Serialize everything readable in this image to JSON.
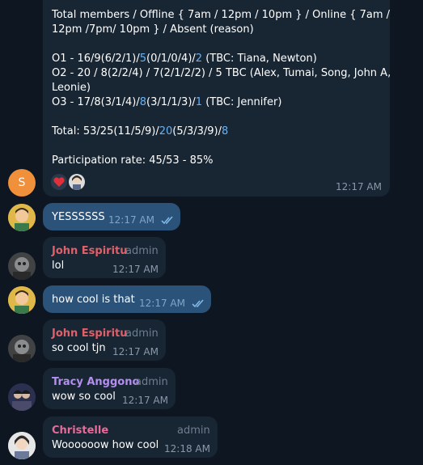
{
  "colors": {
    "background": "#0e1621",
    "incoming_bubble": "#182533",
    "outgoing_bubble": "#2b5278",
    "link": "#6ab3f3",
    "time": "#8a99a9",
    "admin": "#6d7f8f",
    "john_name": "#e0606a",
    "tracy_name": "#b48ef0",
    "christelle_name": "#e86c9a",
    "s_avatar": "#f0903a"
  },
  "summary_message": {
    "line1": "Total members / Offline { 7am / 12pm / 10pm } / Online { 7am /",
    "line2": "12pm /7pm/ 10pm } / Absent (reason)",
    "o1_a": "O1 - 16/9(6/2/1)/",
    "o1_b": "5",
    "o1_c": "(0/1/0/4)/",
    "o1_d": "2",
    "o1_e": " (TBC: Tiana, Newton)",
    "o2_line1": "O2 - 20 / 8(2/2/4) / 7(2/1/2/2) / 5 TBC (Alex, Tumai, Song, John A,",
    "o2_line2": "Leonie)",
    "o3_a": "O3 - 17/8(3/1/4)/",
    "o3_b": "8",
    "o3_c": "(3/1/1/3)/",
    "o3_d": "1",
    "o3_e": " (TBC: Jennifer)",
    "total_a": "Total: 53/25(11/5/9)/",
    "total_b": "20",
    "total_c": "(5/3/3/9)/",
    "total_d": "8",
    "participation": "Participation rate: 45/53 - 85%",
    "time": "12:17 AM",
    "avatar_letter": "S"
  },
  "messages": [
    {
      "text": "YESSSSSS",
      "time": "12:17 AM"
    },
    {
      "sender": "John Espiritu",
      "role": "admin",
      "text": "lol",
      "time": "12:17 AM"
    },
    {
      "text": "how cool is that",
      "time": "12:17 AM"
    },
    {
      "sender": "John Espiritu",
      "role": "admin",
      "text": "so cool tjn",
      "time": "12:17 AM"
    },
    {
      "sender": "Tracy Anggono",
      "role": "admin",
      "text": "wow so cool",
      "time": "12:17 AM"
    },
    {
      "sender": "Christelle",
      "role": "admin",
      "text": "Woooooow how cool",
      "time": "12:18 AM"
    }
  ]
}
